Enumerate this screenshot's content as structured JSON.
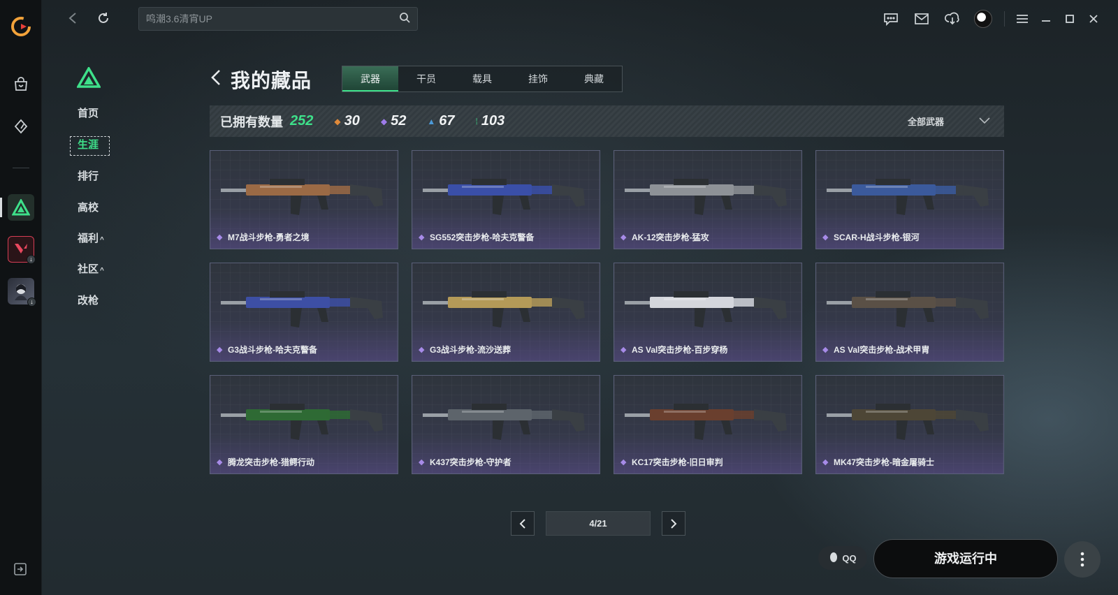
{
  "search": {
    "placeholder": "鸣潮3.6清宵UP"
  },
  "game_nav": {
    "items": [
      {
        "label": "首页",
        "active": false
      },
      {
        "label": "生涯",
        "active": true
      },
      {
        "label": "排行",
        "active": false
      },
      {
        "label": "高校",
        "active": false
      },
      {
        "label": "福利",
        "active": false,
        "caret": "^"
      },
      {
        "label": "社区",
        "active": false,
        "caret": "^"
      },
      {
        "label": "改枪",
        "active": false
      }
    ]
  },
  "header": {
    "title": "我的藏品",
    "tabs": [
      {
        "label": "武器",
        "active": true
      },
      {
        "label": "干员",
        "active": false
      },
      {
        "label": "载具",
        "active": false
      },
      {
        "label": "挂饰",
        "active": false
      },
      {
        "label": "典藏",
        "active": false
      }
    ]
  },
  "stats": {
    "owned_label": "已拥有数量",
    "owned_total": "252",
    "groups": [
      {
        "icon": "orange-diamond-icon",
        "color": "#e08a3a",
        "value": "30"
      },
      {
        "icon": "purple-diamond-icon",
        "color": "#9d7be8",
        "value": "52"
      },
      {
        "icon": "blue-triangle-icon",
        "color": "#4c9ad8",
        "value": "67"
      },
      {
        "icon": "green-dots-icon",
        "color": "#3ee08a",
        "value": "103"
      }
    ],
    "filter_label": "全部武器"
  },
  "items": [
    {
      "name": "M7战斗步枪-勇者之境",
      "tone": "#9b6a45"
    },
    {
      "name": "SG552突击步枪-哈夫克警备",
      "tone": "#3a4fa8"
    },
    {
      "name": "AK-12突击步枪-猛攻",
      "tone": "#8e9297"
    },
    {
      "name": "SCAR-H战斗步枪-银河",
      "tone": "#3b5a9c"
    },
    {
      "name": "G3战斗步枪-哈夫克警备",
      "tone": "#3d4fa5"
    },
    {
      "name": "G3战斗步枪-流沙送葬",
      "tone": "#b49a58"
    },
    {
      "name": "AS Val突击步枪-百步穿杨",
      "tone": "#d4d6dc"
    },
    {
      "name": "AS Val突击步枪-战术甲胄",
      "tone": "#5a5046"
    },
    {
      "name": "腾龙突击步枪-猎鳄行动",
      "tone": "#2e6a34"
    },
    {
      "name": "K437突击步枪-守护者",
      "tone": "#5d646b"
    },
    {
      "name": "KC17突击步枪-旧日审判",
      "tone": "#6a3f2e"
    },
    {
      "name": "MK47突击步枪-暗金屠骑士",
      "tone": "#4d4636"
    }
  ],
  "pagination": {
    "current": "4/21"
  },
  "bottom": {
    "qq_label": "QQ",
    "run_label": "游戏运行中"
  },
  "colors": {
    "accent": "#3ee08a",
    "rarity": "#a78be8"
  }
}
